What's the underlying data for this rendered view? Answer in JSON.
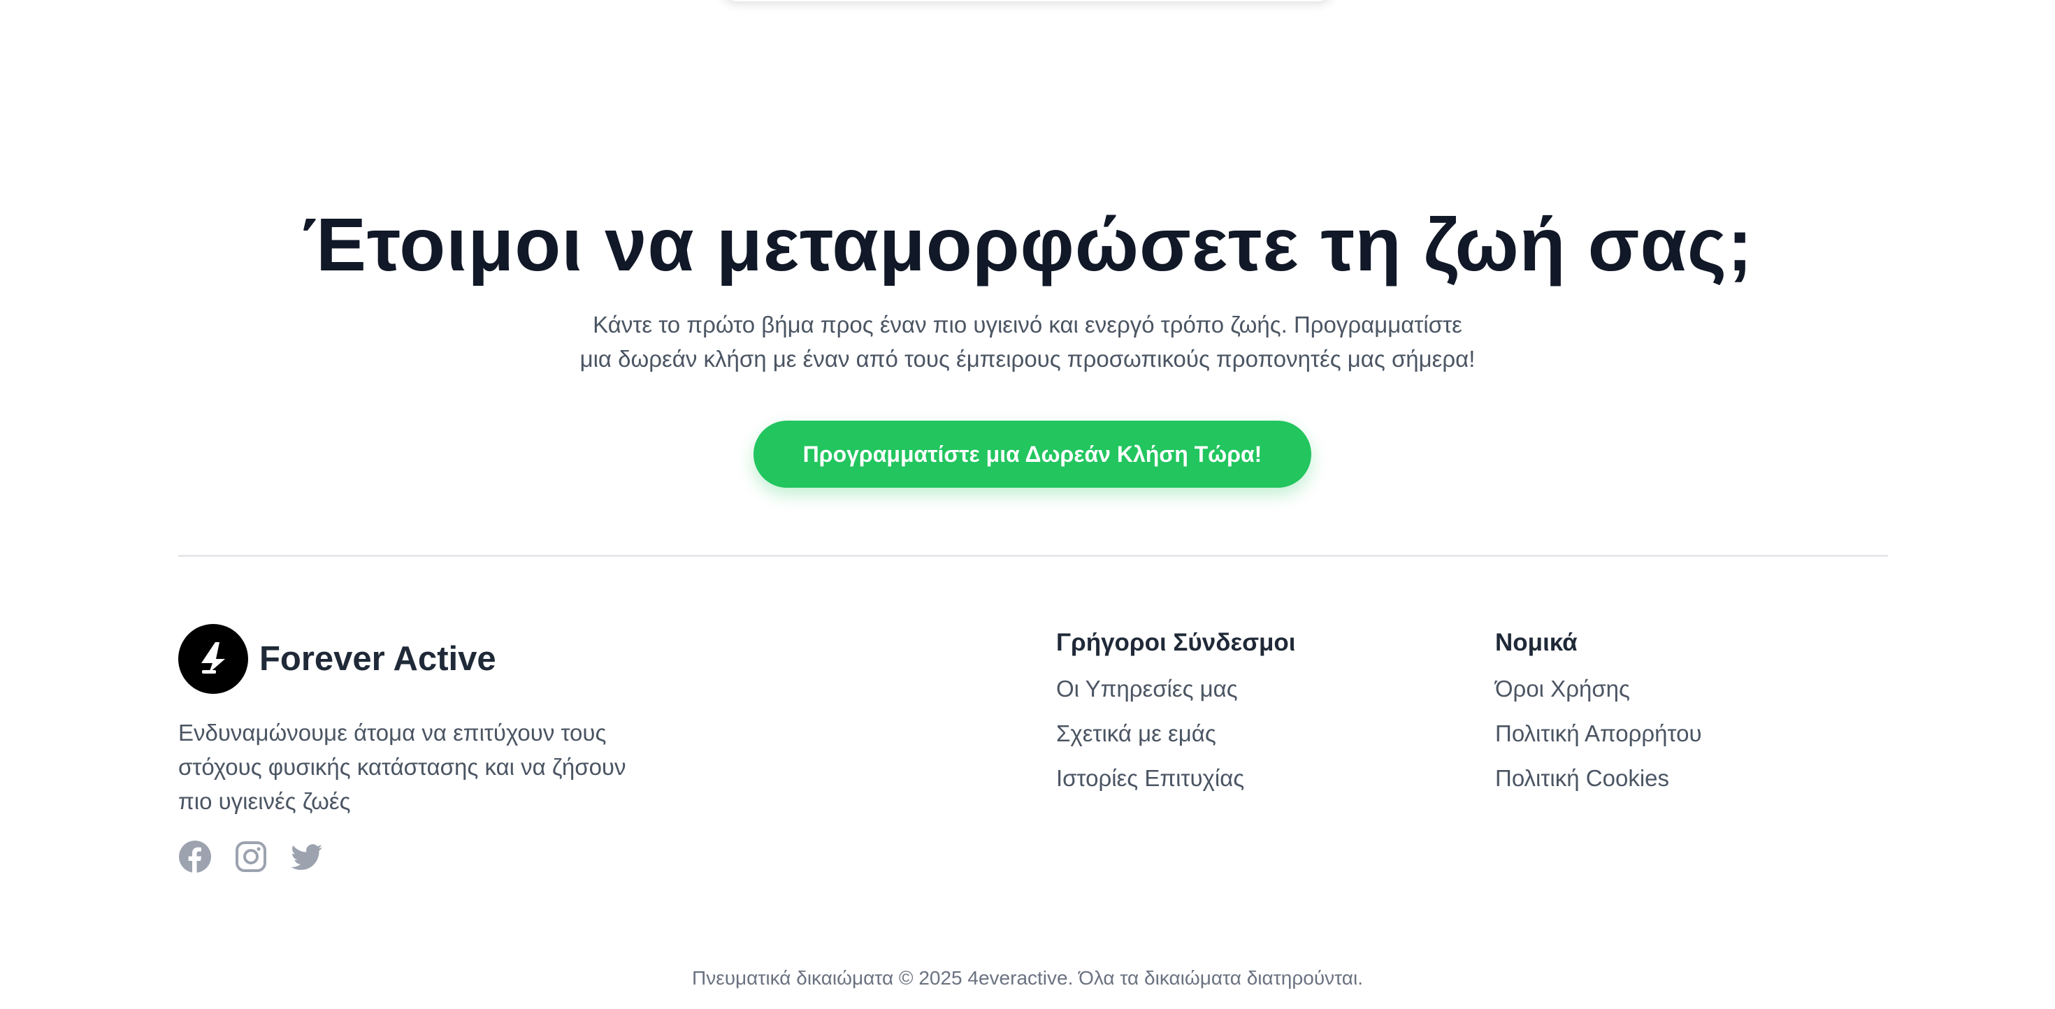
{
  "cta": {
    "title": "Έτοιμοι να μεταμορφώσετε τη ζωή σας;",
    "subtitle_line1": "Κάντε το πρώτο βήμα προς έναν πιο υγιεινό και ενεργό τρόπο ζωής. Προγραμματίστε",
    "subtitle_line2": "μια δωρεάν κλήση με έναν από τους έμπειρους προσωπικούς προπονητές μας σήμερα!",
    "button_label": "Προγραμματίστε μια Δωρεάν Κλήση Τώρα!",
    "button_color": "#22c55e"
  },
  "footer": {
    "brand": {
      "name": "Forever Active",
      "logo_icon": "4-logo-icon",
      "description_line1": "Ενδυναμώνουμε άτομα να επιτύχουν τους",
      "description_line2": "στόχους φυσικής κατάστασης και να ζήσουν",
      "description_line3": "πιο υγιεινές ζωές"
    },
    "socials": [
      {
        "icon": "facebook-icon"
      },
      {
        "icon": "instagram-icon"
      },
      {
        "icon": "twitter-icon"
      }
    ],
    "quick_links": {
      "title": "Γρήγοροι Σύνδεσμοι",
      "items": [
        "Οι Υπηρεσίες μας",
        "Σχετικά με εμάς",
        "Ιστορίες Επιτυχίας"
      ]
    },
    "legal": {
      "title": "Νομικά",
      "items": [
        "Όροι Χρήσης",
        "Πολιτική Απορρήτου",
        "Πολιτική Cookies"
      ]
    },
    "copyright": "Πνευματικά δικαιώματα © 2025 4everactive. Όλα τα δικαιώματα διατηρούνται."
  }
}
